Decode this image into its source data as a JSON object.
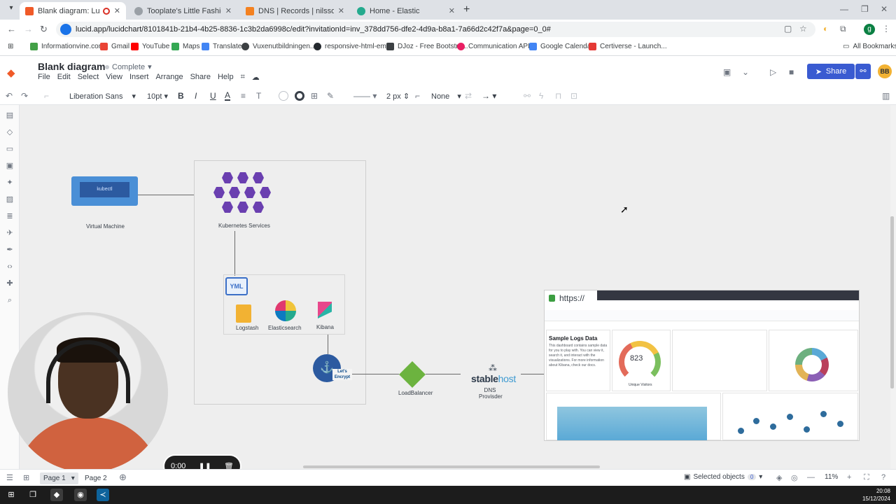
{
  "browser": {
    "tabs": [
      {
        "title": "Blank diagram: Lucidchart",
        "favicon_color": "#f05a28"
      },
      {
        "title": "Tooplate's Little Fashion",
        "favicon_color": "#5f6368"
      },
      {
        "title": "DNS | Records | nilssonsstadtja",
        "favicon_color": "#f48120"
      },
      {
        "title": "Home - Elastic",
        "favicon_color": "#24aa8e"
      }
    ],
    "url": "lucid.app/lucidchart/8101841b-21b4-4b25-8836-1c3b2da6998c/edit?invitationId=inv_378dd756-dfe2-4d9a-b8a1-7a66d2c42f7a&page=0_0#",
    "profile_initial": "g",
    "bookmarks": [
      {
        "label": "Informationvine.com",
        "color": "#43a047"
      },
      {
        "label": "Gmail",
        "color": "#ea4335"
      },
      {
        "label": "YouTube",
        "color": "#ff0000"
      },
      {
        "label": "Maps",
        "color": "#34a853"
      },
      {
        "label": "Translate",
        "color": "#4285f4"
      },
      {
        "label": "Vuxenutbildningen...",
        "color": "#3c4043"
      },
      {
        "label": "responsive-html-em...",
        "color": "#24292e"
      },
      {
        "label": "DJoz - Free Bootstra...",
        "color": "#3c4043"
      },
      {
        "label": "Communication API...",
        "color": "#e91e63"
      },
      {
        "label": "Google Calendar",
        "color": "#4285f4"
      },
      {
        "label": "Certiverse - Launch...",
        "color": "#e53935"
      }
    ],
    "all_bookmarks": "All Bookmarks"
  },
  "lucid": {
    "doc_title": "Blank diagram",
    "status": "Complete",
    "menu": [
      "File",
      "Edit",
      "Select",
      "View",
      "Insert",
      "Arrange",
      "Share",
      "Help"
    ],
    "share_label": "Share",
    "user_initials": "BB",
    "toolbar": {
      "font": "Liberation Sans",
      "font_size": "10pt",
      "line_width": "2 px",
      "arrow_start": "None"
    }
  },
  "diagram": {
    "vm_screen_text": "kubectl",
    "vm_label": "Virtual Machine",
    "k8s_label": "Kubernetes Services",
    "yml_label": "YML",
    "logstash_label": "Logstash",
    "elasticsearch_label": "Elasticsearch",
    "kibana_label": "Kibana",
    "letsencrypt_label": "Let's Encrypt",
    "lb_label": "LoadBalancer",
    "stablehost_a": "stable",
    "stablehost_b": "host",
    "dns_label": "DNS Provisder",
    "kibana_shot": {
      "url_prefix": "https://",
      "panel_title": "Sample Logs Data",
      "panel_text": "This dashboard contains sample data for you to play with. You can view it, search it, and interact with the visualizations. For more information about Kibana, check our docs.",
      "gauge_value": "823",
      "gauge_label": "Unique Visitors"
    }
  },
  "recorder": {
    "time": "0:00"
  },
  "bottom": {
    "pages": [
      "Page 1",
      "Page 2"
    ],
    "selected_objects": "Selected objects",
    "selected_count": "0",
    "zoom": "11%"
  },
  "taskbar": {
    "time": "20:08",
    "date": "15/12/2024"
  }
}
